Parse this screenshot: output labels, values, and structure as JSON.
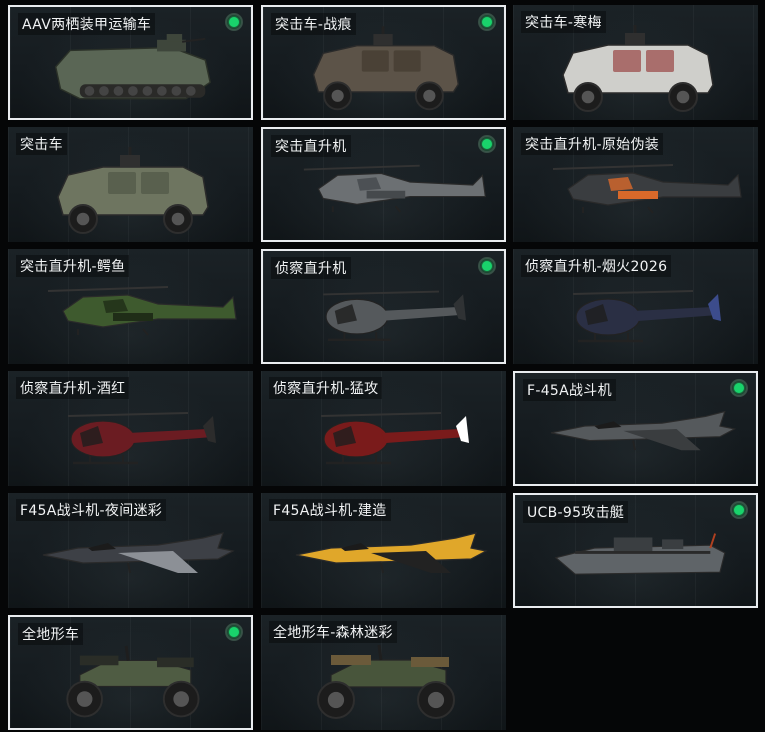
{
  "vehicles": [
    {
      "name": "AAV两栖装甲运输车",
      "owned": true,
      "selected": true,
      "kind": "amphibious",
      "color": "#5a6655",
      "accent": "#3e463b"
    },
    {
      "name": "突击车-战痕",
      "owned": true,
      "selected": true,
      "kind": "armored-car",
      "color": "#5c5348",
      "accent": "#3d352c"
    },
    {
      "name": "突击车-寒梅",
      "owned": false,
      "selected": false,
      "kind": "armored-car",
      "color": "#cfcfcb",
      "accent": "#8f2d2d"
    },
    {
      "name": "突击车",
      "owned": false,
      "selected": false,
      "kind": "armored-car",
      "color": "#6e7560",
      "accent": "#4b5142"
    },
    {
      "name": "突击直升机",
      "owned": true,
      "selected": true,
      "kind": "attack-heli",
      "color": "#6c7073",
      "accent": "#45494c"
    },
    {
      "name": "突击直升机-原始伪装",
      "owned": false,
      "selected": false,
      "kind": "attack-heli",
      "color": "#3a3d40",
      "accent": "#d9692a"
    },
    {
      "name": "突击直升机-鳄鱼",
      "owned": false,
      "selected": false,
      "kind": "attack-heli",
      "color": "#3e5a2e",
      "accent": "#1f2d17"
    },
    {
      "name": "侦察直升机",
      "owned": true,
      "selected": true,
      "kind": "scout-heli",
      "color": "#55595c",
      "accent": "#2f3234"
    },
    {
      "name": "侦察直升机-烟火2026",
      "owned": false,
      "selected": false,
      "kind": "scout-heli",
      "color": "#2a2f44",
      "accent": "#3c4c8c"
    },
    {
      "name": "侦察直升机-酒红",
      "owned": false,
      "selected": false,
      "kind": "scout-heli",
      "color": "#6b1c22",
      "accent": "#2c2c2c"
    },
    {
      "name": "侦察直升机-猛攻",
      "owned": false,
      "selected": false,
      "kind": "scout-heli",
      "color": "#7a1b1b",
      "accent": "#ffffff"
    },
    {
      "name": "F-45A战斗机",
      "owned": true,
      "selected": true,
      "kind": "jet",
      "color": "#55595c",
      "accent": "#3a3d3f"
    },
    {
      "name": "F45A战斗机-夜间迷彩",
      "owned": false,
      "selected": false,
      "kind": "jet",
      "color": "#3d4046",
      "accent": "#8c9096"
    },
    {
      "name": "F45A战斗机-建造",
      "owned": false,
      "selected": false,
      "kind": "jet",
      "color": "#e0a72a",
      "accent": "#222222"
    },
    {
      "name": "UCB-95攻击艇",
      "owned": true,
      "selected": true,
      "kind": "boat",
      "color": "#5f6468",
      "accent": "#3a3e41"
    },
    {
      "name": "全地形车",
      "owned": true,
      "selected": true,
      "kind": "atv",
      "color": "#4f5c43",
      "accent": "#2a2d27"
    },
    {
      "name": "全地形车-森林迷彩",
      "owned": false,
      "selected": false,
      "kind": "atv",
      "color": "#48553b",
      "accent": "#6b5a3a"
    }
  ],
  "icons": {
    "owned": "green-dot-icon"
  }
}
